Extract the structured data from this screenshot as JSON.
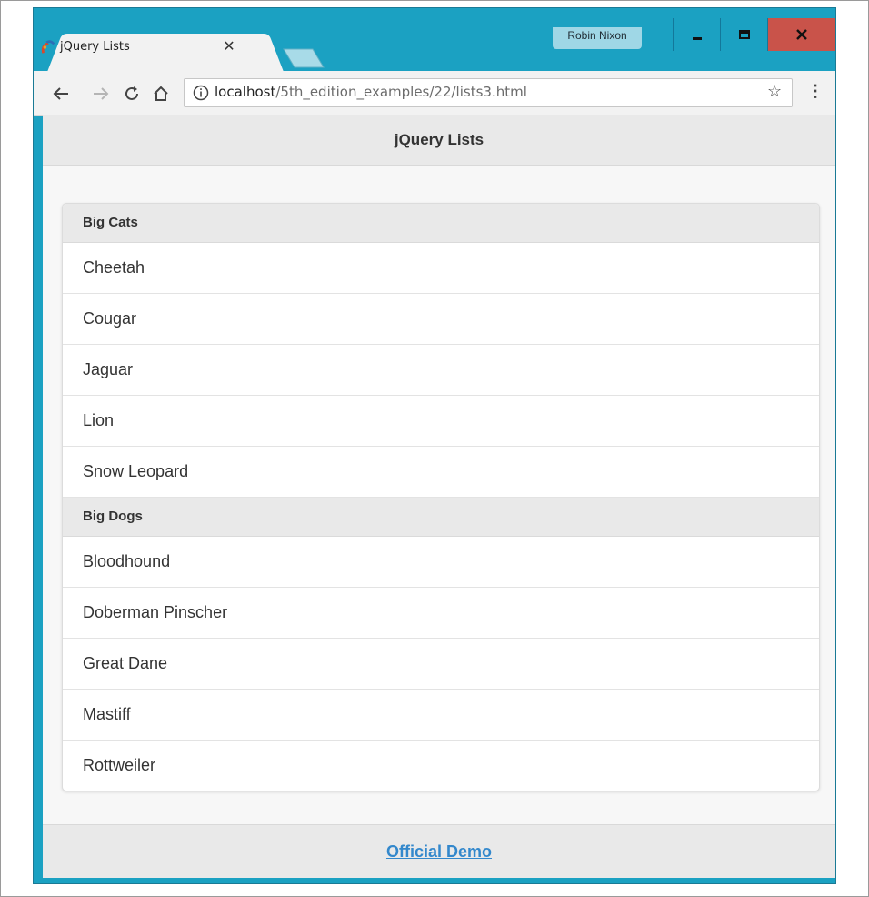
{
  "browser": {
    "tab_title": "jQuery Lists",
    "user_name": "Robin Nixon",
    "url_host": "localhost",
    "url_path": "/5th_edition_examples/22/lists3.html"
  },
  "page": {
    "header_title": "jQuery Lists",
    "footer_link": "Official Demo",
    "groups": [
      {
        "title": "Big Cats",
        "items": [
          "Cheetah",
          "Cougar",
          "Jaguar",
          "Lion",
          "Snow Leopard"
        ]
      },
      {
        "title": "Big Dogs",
        "items": [
          "Bloodhound",
          "Doberman Pinscher",
          "Great Dane",
          "Mastiff",
          "Rottweiler"
        ]
      }
    ]
  },
  "colors": {
    "window_frame": "#1ba1c2",
    "close_button": "#c9534a",
    "link": "#3388cc"
  }
}
